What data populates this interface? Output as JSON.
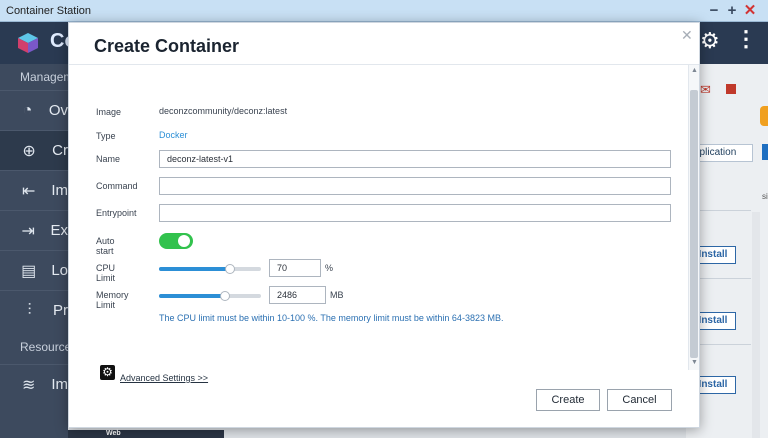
{
  "window": {
    "title": "Container Station",
    "min": "−",
    "max": "+",
    "close": "✕"
  },
  "app": {
    "header_text": "Co",
    "sidebar": {
      "section1": "Manageme",
      "items": [
        {
          "label": "Ov",
          "icon": "dashboard-icon",
          "glyph": "◔"
        },
        {
          "label": "Cr",
          "icon": "create-icon",
          "glyph": "⊕"
        },
        {
          "label": "Im",
          "icon": "import-icon",
          "glyph": "⇤"
        },
        {
          "label": "Ex",
          "icon": "export-icon",
          "glyph": "⇥"
        },
        {
          "label": "Lo",
          "icon": "log-icon",
          "glyph": "▤"
        },
        {
          "label": "Pr",
          "icon": "preferences-icon",
          "glyph": "⫶"
        }
      ],
      "section2": "Resource",
      "items2": [
        {
          "label": "Im",
          "icon": "layers-icon",
          "glyph": "≋"
        }
      ]
    },
    "right": {
      "app_button": "pplication",
      "install_1": "Install",
      "install_2": "Install",
      "install_3": "Install",
      "cut_char": "si",
      "bottom_text": "Web"
    }
  },
  "dialog": {
    "title": "Create Container",
    "fields": {
      "image_label": "Image",
      "image_value": "deconzcommunity/deconz:latest",
      "type_label": "Type",
      "type_value": "Docker",
      "name_label": "Name",
      "name_value": "deconz-latest-v1",
      "command_label": "Command",
      "command_value": "",
      "entrypoint_label": "Entrypoint",
      "entrypoint_value": "",
      "autostart_label": "Auto start",
      "autostart_on": true,
      "cpu_label": "CPU Limit",
      "cpu_value": "70",
      "cpu_unit": "%",
      "cpu_fraction": 0.7,
      "mem_label": "Memory Limit",
      "mem_value": "2486",
      "mem_unit": "MB",
      "mem_fraction": 0.65
    },
    "hint": "The CPU limit must be within 10-100 %. The memory limit must be within 64-3823 MB.",
    "advanced_link": "Advanced Settings >>",
    "create_button": "Create",
    "cancel_button": "Cancel"
  }
}
